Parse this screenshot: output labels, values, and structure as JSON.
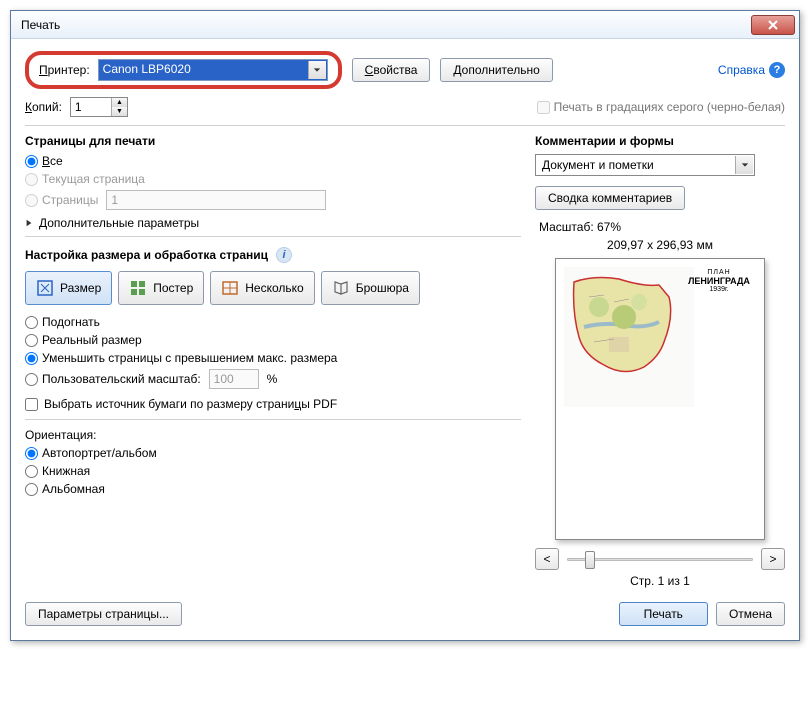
{
  "titlebar": {
    "title": "Печать"
  },
  "header": {
    "printer_label": "Принтер:",
    "printer_value": "Canon LBP6020",
    "properties_btn": "Свойства",
    "advanced_btn": "Дополнительно",
    "help_link": "Справка",
    "copies_label": "Копий:",
    "copies_value": "1",
    "grayscale_label": "Печать в градациях серого (черно-белая)"
  },
  "pages": {
    "title": "Страницы для печати",
    "all": "Все",
    "current": "Текущая страница",
    "range_label": "Страницы",
    "range_value": "1",
    "more": "Дополнительные параметры"
  },
  "sizing": {
    "title": "Настройка размера и обработка страниц",
    "size_btn": "Размер",
    "poster_btn": "Постер",
    "multiple_btn": "Несколько",
    "booklet_btn": "Брошюра",
    "fit": "Подогнать",
    "actual": "Реальный размер",
    "shrink": "Уменьшить страницы с превышением макс. размера",
    "custom": "Пользовательский масштаб:",
    "custom_value": "100",
    "percent": "%",
    "paper_source": "Выбрать источник бумаги по размеру страницы PDF"
  },
  "orientation": {
    "title": "Ориентация:",
    "auto": "Автопортрет/альбом",
    "portrait": "Книжная",
    "landscape": "Альбомная"
  },
  "comments": {
    "title": "Комментарии и формы",
    "combo_value": "Документ и пометки",
    "summary_btn": "Сводка комментариев"
  },
  "preview": {
    "scale_label": "Масштаб:  67%",
    "dims": "209,97 x 296,93 мм",
    "map_title_small": "ПЛАН",
    "map_title_big": "ЛЕНИНГРАДА",
    "map_year": "1939г.",
    "page_info": "Стр. 1 из 1",
    "prev": "<",
    "next": ">"
  },
  "footer": {
    "page_setup": "Параметры страницы...",
    "print": "Печать",
    "cancel": "Отмена"
  }
}
